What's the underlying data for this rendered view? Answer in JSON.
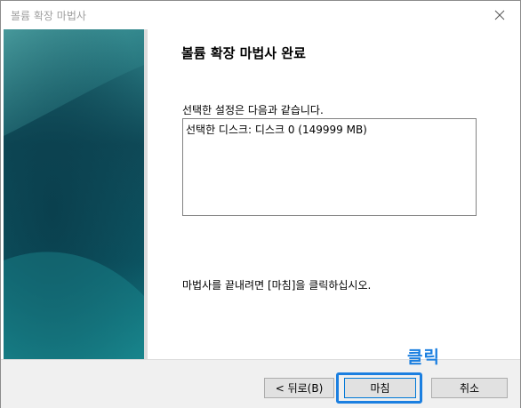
{
  "window": {
    "title": "볼륨 확장 마법사",
    "close_icon": "close-icon"
  },
  "main": {
    "heading": "볼륨 확장 마법사 완료",
    "info_label": "선택한 설정은 다음과 같습니다.",
    "settings_text": "선택한 디스크: 디스크 0 (149999 MB)",
    "finish_hint": "마법사를 끝내려면 [마침]을 클릭하십시오."
  },
  "buttons": {
    "back": "< 뒤로(B)",
    "finish": "마침",
    "cancel": "취소"
  },
  "annotation": {
    "callout": "클릭",
    "color": "#1b7fe0"
  },
  "colors": {
    "panel_dark": "#0d3c4a",
    "panel_teal": "#11707b",
    "panel_light": "#2a8f92"
  }
}
